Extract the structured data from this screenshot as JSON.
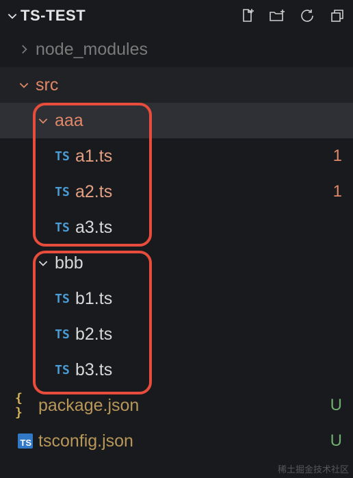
{
  "header": {
    "title": "TS-TEST"
  },
  "tree": {
    "node_modules": "node_modules",
    "src": "src",
    "aaa": "aaa",
    "a1": "a1.ts",
    "a2": "a2.ts",
    "a3": "a3.ts",
    "bbb": "bbb",
    "b1": "b1.ts",
    "b2": "b2.ts",
    "b3": "b3.ts",
    "package_json": "package.json",
    "tsconfig_json": "tsconfig.json"
  },
  "icons": {
    "ts": "TS",
    "ts_square": "TS",
    "json_brace": "{ }"
  },
  "badges": {
    "a1": "1",
    "a2": "1",
    "pkg": "U",
    "tscfg": "U"
  },
  "watermark": "稀土掘金技术社区"
}
